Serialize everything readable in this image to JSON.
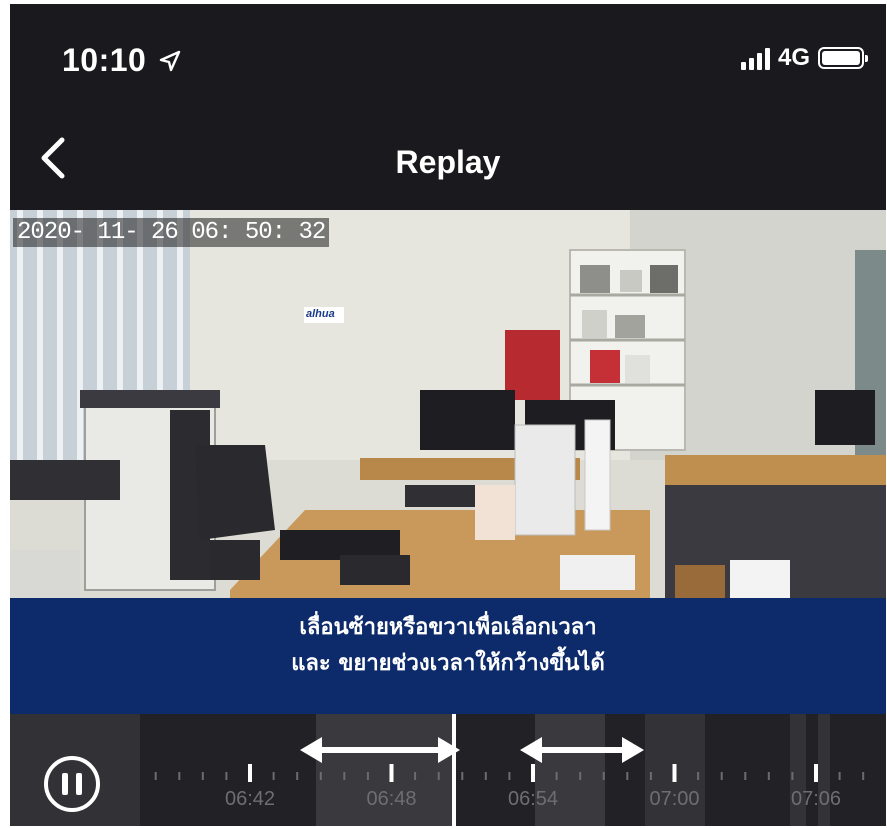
{
  "status_bar": {
    "time": "10:10",
    "network": "4G"
  },
  "nav": {
    "title": "Replay"
  },
  "video": {
    "timestamp": "2020- 11- 26  06: 50: 32",
    "brand_sign": "alhua"
  },
  "caption": {
    "line1": "เลื่อนซ้ายหรือขวาเพื่อเลือกเวลา",
    "line2": "และ ขยายช่วงเวลาให้กว้างขึ้นได้"
  },
  "timeline": {
    "labels": [
      "06:42",
      "06:48",
      "06:54",
      "07:00",
      "07:06"
    ],
    "playhead_time": "06:50:32"
  },
  "colors": {
    "background": "#1a1a1e",
    "caption_bg": "#0d2a6b",
    "timeline_bg": "#222226",
    "recorded_segment": "#3a3a3e"
  }
}
